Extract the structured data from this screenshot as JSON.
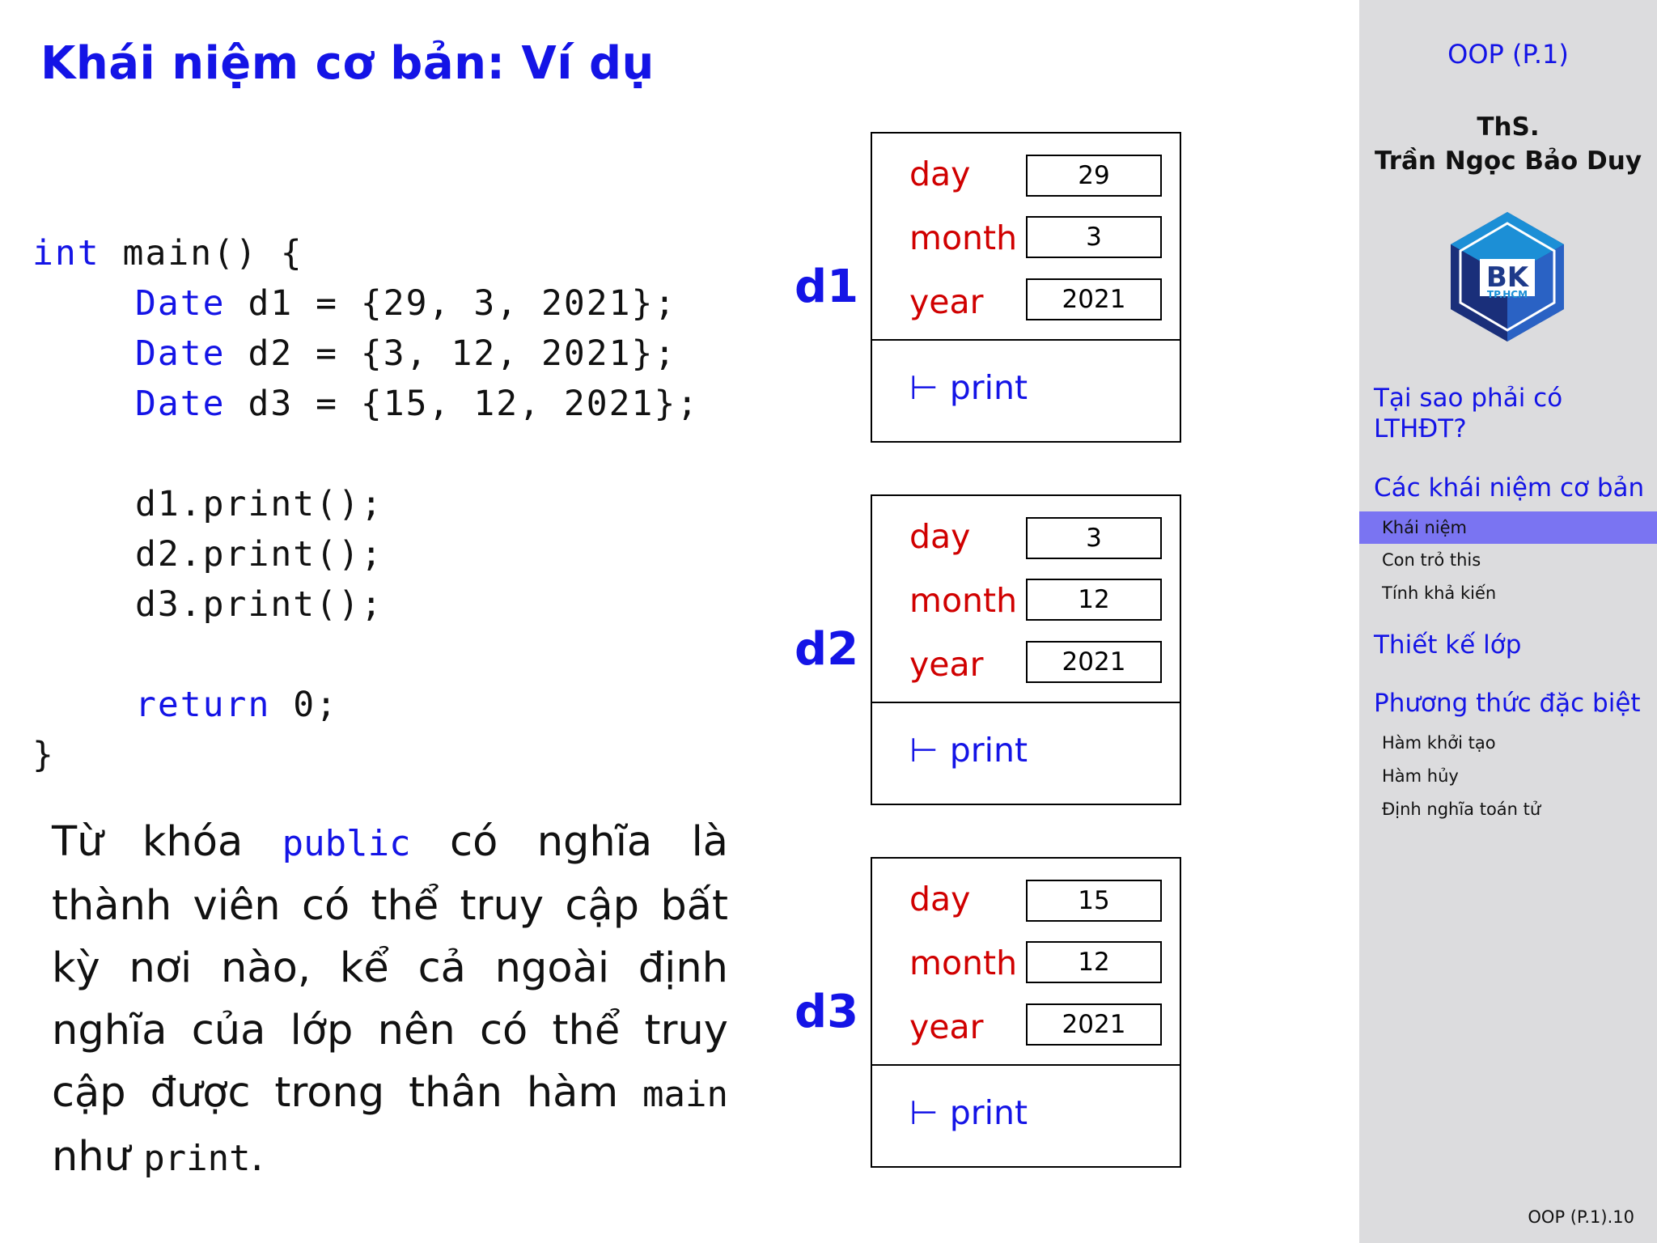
{
  "title": "Khái niệm cơ bản: Ví dụ",
  "code": {
    "line1": {
      "kw": "int",
      "rest": " main() {"
    },
    "line2": {
      "kw": "Date",
      "rest": " d1 = {29, 3, 2021};"
    },
    "line3": {
      "kw": "Date",
      "rest": " d2 = {3, 12, 2021};"
    },
    "line4": {
      "kw": "Date",
      "rest": " d3 = {15, 12, 2021};"
    },
    "line5": "d1.print();",
    "line6": "d2.print();",
    "line7": "d3.print();",
    "line8": {
      "kw": "return",
      "rest": " 0;"
    },
    "line9": "}"
  },
  "paragraph": {
    "p1": "Từ khóa ",
    "public": "public",
    "p2": " có nghĩa là thành viên có thể truy cập bất kỳ nơi nào, kể cả ngoài định nghĩa của lớp nên có thể truy cập được trong thân hàm ",
    "main": "main",
    "p3": " như ",
    "print": "print",
    "p4": "."
  },
  "objects": [
    {
      "label": "d1",
      "fields": [
        {
          "name": "day",
          "value": "29"
        },
        {
          "name": "month",
          "value": "3"
        },
        {
          "name": "year",
          "value": "2021"
        }
      ],
      "method": "print"
    },
    {
      "label": "d2",
      "fields": [
        {
          "name": "day",
          "value": "3"
        },
        {
          "name": "month",
          "value": "12"
        },
        {
          "name": "year",
          "value": "2021"
        }
      ],
      "method": "print"
    },
    {
      "label": "d3",
      "fields": [
        {
          "name": "day",
          "value": "15"
        },
        {
          "name": "month",
          "value": "12"
        },
        {
          "name": "year",
          "value": "2021"
        }
      ],
      "method": "print"
    }
  ],
  "method_symbol": "⊢",
  "sidebar": {
    "title": "OOP (P.1)",
    "author_line1": "ThS.",
    "author_line2": "Trần Ngọc Bảo Duy",
    "logo_text": "BK",
    "logo_subtext": "TP.HCM",
    "sections": [
      {
        "label": "Tại sao phải có LTHĐT?"
      },
      {
        "label": "Các khái niệm cơ bản",
        "subs": [
          "Khái niệm",
          "Con trỏ this",
          "Tính khả kiến"
        ]
      },
      {
        "label": "Thiết kế lớp"
      },
      {
        "label": "Phương thức đặc biệt",
        "subs": [
          "Hàm khởi tạo",
          "Hàm hủy",
          "Định nghĩa toán tử"
        ]
      }
    ],
    "active_sub": "Khái niệm",
    "footer": "OOP (P.1).10"
  },
  "colors": {
    "accent": "#1414e6",
    "field": "#d00000",
    "sidebar_bg": "#dcdcde",
    "active_bg": "#7a74f2"
  }
}
